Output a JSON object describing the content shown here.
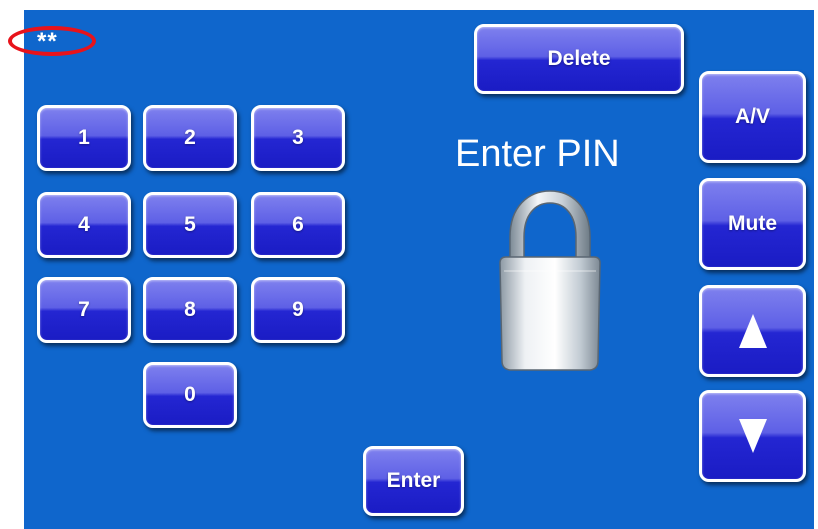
{
  "pin_display": "**",
  "title": "Enter PIN",
  "keypad": {
    "k1": "1",
    "k2": "2",
    "k3": "3",
    "k4": "4",
    "k5": "5",
    "k6": "6",
    "k7": "7",
    "k8": "8",
    "k9": "9",
    "k0": "0"
  },
  "buttons": {
    "delete": "Delete",
    "enter": "Enter",
    "av": "A/V",
    "mute": "Mute"
  },
  "icons": {
    "lock": "padlock-icon",
    "volume_up": "arrow-up-icon",
    "volume_down": "arrow-down-icon"
  },
  "colors": {
    "background": "#0f66cc",
    "button": "#2426d2",
    "highlight": "#e8131b",
    "text": "#ffffff"
  }
}
